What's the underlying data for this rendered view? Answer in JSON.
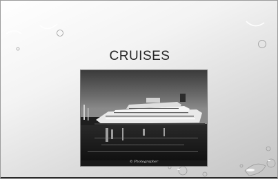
{
  "slide": {
    "title": "CRUISES",
    "image": {
      "subject": "cruise-ship-photo",
      "watermark": "© Photographer"
    }
  },
  "colors": {
    "title": "#262626",
    "background_light": "#ffffff",
    "background_dark": "#c4c4c4"
  }
}
